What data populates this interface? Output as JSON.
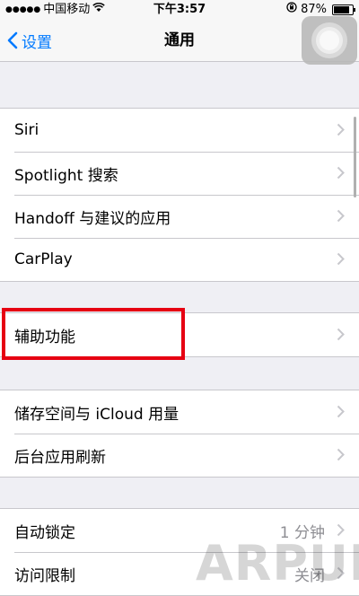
{
  "status": {
    "carrier": "中国移动",
    "time": "下午3:57",
    "battery": "87%",
    "battery_level": 0.87
  },
  "nav": {
    "back_label": "设置",
    "title": "通用"
  },
  "groups": [
    {
      "items": [
        {
          "label": "Siri"
        },
        {
          "label": "Spotlight 搜索"
        },
        {
          "label": "Handoff 与建议的应用"
        },
        {
          "label": "CarPlay"
        }
      ]
    },
    {
      "items": [
        {
          "label": "辅助功能"
        }
      ]
    },
    {
      "items": [
        {
          "label": "储存空间与 iCloud 用量"
        },
        {
          "label": "后台应用刷新"
        }
      ]
    },
    {
      "items": [
        {
          "label": "自动锁定",
          "value": "1 分钟"
        },
        {
          "label": "访问限制",
          "value": "关闭"
        }
      ]
    }
  ],
  "watermark": "ARPUN.COM",
  "colors": {
    "accent": "#007aff",
    "highlight": "#e60012"
  }
}
